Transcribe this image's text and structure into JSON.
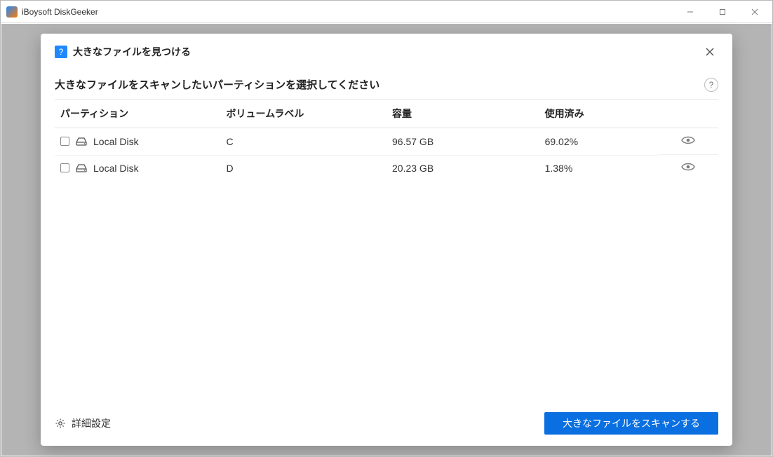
{
  "window": {
    "title": "iBoysoft DiskGeeker"
  },
  "modal": {
    "icon_glyph": "?",
    "title": "大きなファイルを見つける",
    "instruction": "大きなファイルをスキャンしたいパーティションを選択してください",
    "help_glyph": "?",
    "columns": {
      "partition": "パーティション",
      "label": "ボリュームラベル",
      "capacity": "容量",
      "used": "使用済み"
    },
    "rows": [
      {
        "checked": false,
        "name": "Local Disk",
        "label": "C",
        "capacity": "96.57 GB",
        "used": "69.02%"
      },
      {
        "checked": false,
        "name": "Local Disk",
        "label": "D",
        "capacity": "20.23 GB",
        "used": "1.38%"
      }
    ],
    "advanced_label": "詳細設定",
    "scan_button": "大きなファイルをスキャンする"
  }
}
